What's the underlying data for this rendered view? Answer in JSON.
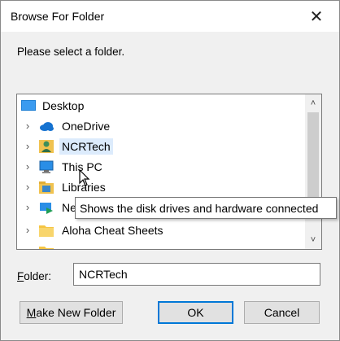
{
  "window": {
    "title": "Browse For Folder",
    "close_glyph": "✕"
  },
  "prompt": "Please select a folder.",
  "tree": {
    "items": [
      {
        "label": "Desktop",
        "icon": "desktop-icon",
        "expander": ""
      },
      {
        "label": "OneDrive",
        "icon": "cloud-icon",
        "expander": "›"
      },
      {
        "label": "NCRTech",
        "icon": "user-folder-icon",
        "expander": "›",
        "selected": true
      },
      {
        "label": "This PC",
        "icon": "computer-icon",
        "expander": "›"
      },
      {
        "label": "Libraries",
        "icon": "libraries-icon",
        "expander": "›"
      },
      {
        "label": "Ne",
        "icon": "network-icon",
        "expander": "›"
      },
      {
        "label": "Aloha Cheat Sheets",
        "icon": "folder-icon",
        "expander": "›"
      },
      {
        "label": "",
        "icon": "folder-icon",
        "expander": ""
      }
    ]
  },
  "scrollbar": {
    "up": "˄",
    "down": "˅"
  },
  "tooltip": "Shows the disk drives and hardware connected",
  "folder_field": {
    "label_accel": "F",
    "label_rest": "older:",
    "value": "NCRTech"
  },
  "buttons": {
    "make_new_accel": "M",
    "make_new_rest": "ake New Folder",
    "ok": "OK",
    "cancel": "Cancel"
  },
  "colors": {
    "accent": "#0078d7",
    "selection": "#dcebfc",
    "folder": "#f5c543"
  }
}
